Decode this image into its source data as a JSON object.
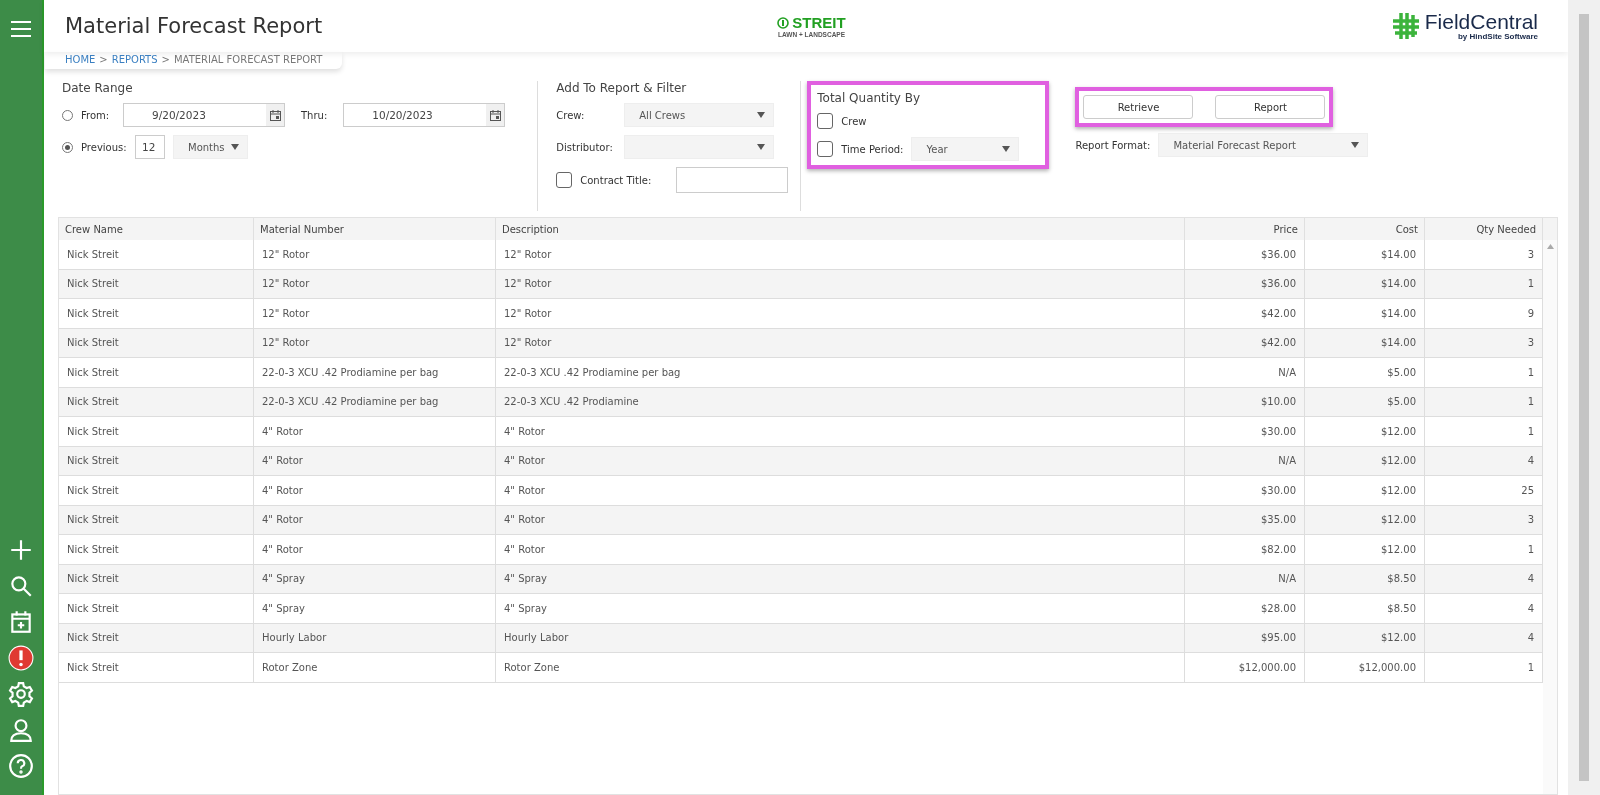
{
  "header": {
    "title": "Material Forecast Report",
    "breadcrumb": [
      {
        "label": "HOME",
        "kind": "link"
      },
      {
        "label": ">",
        "kind": "sep"
      },
      {
        "label": "REPORTS",
        "kind": "link"
      },
      {
        "label": ">",
        "kind": "sep"
      },
      {
        "label": "MATERIAL FORECAST REPORT",
        "kind": "current"
      }
    ],
    "company_logo": {
      "name": "STREIT",
      "tagline": "LAWN + LANDSCAPE"
    },
    "app_logo": {
      "name": "FieldCentral",
      "tagline": "by HindSite Software"
    }
  },
  "date_range": {
    "title": "Date Range",
    "options": [
      {
        "label": "From:",
        "selected": false
      },
      {
        "label": "Previous:",
        "selected": true
      }
    ],
    "from": "9/20/2023",
    "thru_label": "Thru:",
    "thru": "10/20/2023",
    "previous": "12",
    "unit": "Months"
  },
  "filter": {
    "title": "Add To Report & Filter",
    "crew_label": "Crew:",
    "crew": "All Crews",
    "distributor_label": "Distributor:",
    "contract": {
      "label": "Contract Title:",
      "checked": false
    }
  },
  "total_by": {
    "title": "Total Quantity By",
    "highlighted": true,
    "crew": {
      "label": "Crew",
      "checked": false
    },
    "time_period": {
      "label": "Time Period:",
      "checked": false,
      "value": "Year"
    }
  },
  "actions": {
    "highlighted": true,
    "buttons": [
      "Retrieve",
      "Report"
    ],
    "format_label": "Report Format:",
    "format": "Material Forecast Report"
  },
  "table": {
    "columns": [
      "Crew Name",
      "Material Number",
      "Description",
      "Price",
      "Cost",
      "Qty Needed"
    ],
    "rows": [
      [
        "Nick Streit",
        "12\" Rotor",
        "12\" Rotor",
        "$36.00",
        "$14.00",
        "3"
      ],
      [
        "Nick Streit",
        "12\" Rotor",
        "12\" Rotor",
        "$36.00",
        "$14.00",
        "1"
      ],
      [
        "Nick Streit",
        "12\" Rotor",
        "12\" Rotor",
        "$42.00",
        "$14.00",
        "9"
      ],
      [
        "Nick Streit",
        "12\" Rotor",
        "12\" Rotor",
        "$42.00",
        "$14.00",
        "3"
      ],
      [
        "Nick Streit",
        "22-0-3 XCU .42 Prodiamine per bag",
        "22-0-3 XCU .42 Prodiamine per bag",
        "N/A",
        "$5.00",
        "1"
      ],
      [
        "Nick Streit",
        "22-0-3 XCU .42 Prodiamine per bag",
        "22-0-3 XCU .42 Prodiamine",
        "$10.00",
        "$5.00",
        "1"
      ],
      [
        "Nick Streit",
        "4\" Rotor",
        "4\" Rotor",
        "$30.00",
        "$12.00",
        "1"
      ],
      [
        "Nick Streit",
        "4\" Rotor",
        "4\" Rotor",
        "N/A",
        "$12.00",
        "4"
      ],
      [
        "Nick Streit",
        "4\" Rotor",
        "4\" Rotor",
        "$30.00",
        "$12.00",
        "25"
      ],
      [
        "Nick Streit",
        "4\" Rotor",
        "4\" Rotor",
        "$35.00",
        "$12.00",
        "3"
      ],
      [
        "Nick Streit",
        "4\" Rotor",
        "4\" Rotor",
        "$82.00",
        "$12.00",
        "1"
      ],
      [
        "Nick Streit",
        "4\" Spray",
        "4\" Spray",
        "N/A",
        "$8.50",
        "4"
      ],
      [
        "Nick Streit",
        "4\" Spray",
        "4\" Spray",
        "$28.00",
        "$8.50",
        "4"
      ],
      [
        "Nick Streit",
        "Hourly Labor",
        "Hourly Labor",
        "$95.00",
        "$12.00",
        "4"
      ],
      [
        "Nick Streit",
        "Rotor Zone",
        "Rotor Zone",
        "$12,000.00",
        "$12,000.00",
        "1"
      ]
    ]
  }
}
